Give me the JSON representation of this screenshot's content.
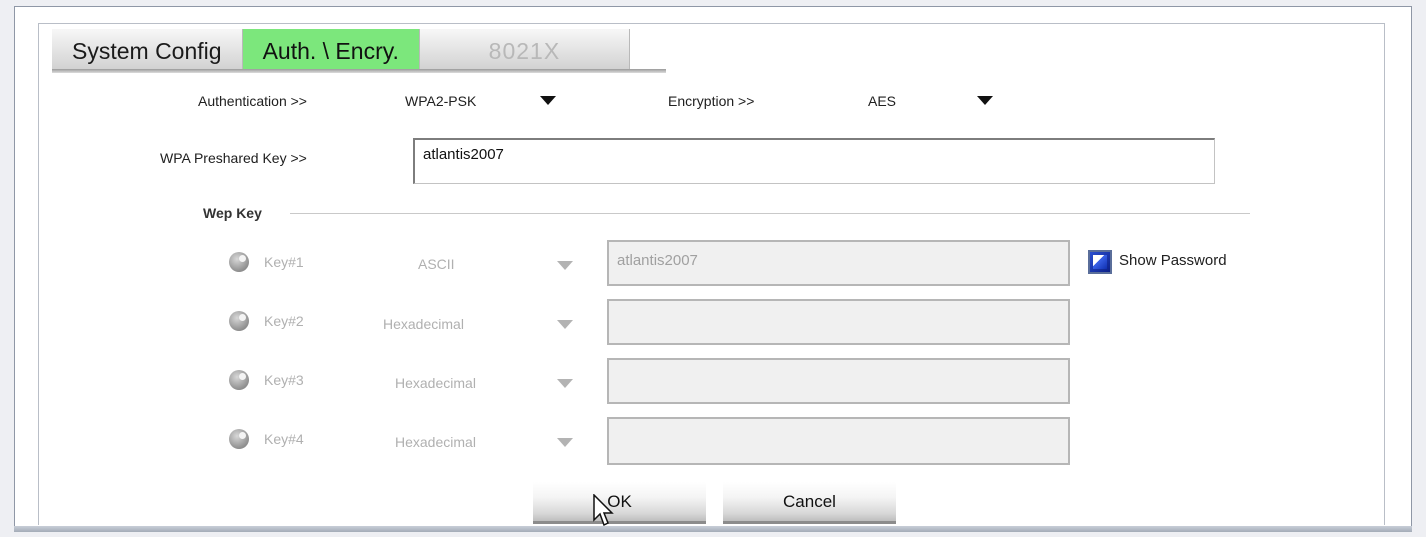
{
  "tabs": [
    {
      "label": "System Config",
      "state": "normal"
    },
    {
      "label": "Auth. \\ Encry.",
      "state": "active"
    },
    {
      "label": "8021X",
      "state": "disabled"
    }
  ],
  "auth": {
    "label": "Authentication >>",
    "value": "WPA2-PSK",
    "encryption_label": "Encryption >>",
    "encryption_value": "AES"
  },
  "psk": {
    "label": "WPA Preshared Key >>",
    "value": "atlantis2007"
  },
  "wep": {
    "title": "Wep Key",
    "keys": [
      {
        "label": "Key#1",
        "format": "ASCII",
        "value": "atlantis2007"
      },
      {
        "label": "Key#2",
        "format": "Hexadecimal",
        "value": ""
      },
      {
        "label": "Key#3",
        "format": "Hexadecimal",
        "value": ""
      },
      {
        "label": "Key#4",
        "format": "Hexadecimal",
        "value": ""
      }
    ],
    "show_password_label": "Show Password",
    "show_password_checked": true
  },
  "buttons": {
    "ok": "OK",
    "cancel": "Cancel"
  },
  "colors": {
    "active_tab": "#7ce77c",
    "checkbox": "#1a3bd0"
  },
  "icons": {
    "dropdown": "triangle-down",
    "cursor": "mouse-pointer"
  }
}
